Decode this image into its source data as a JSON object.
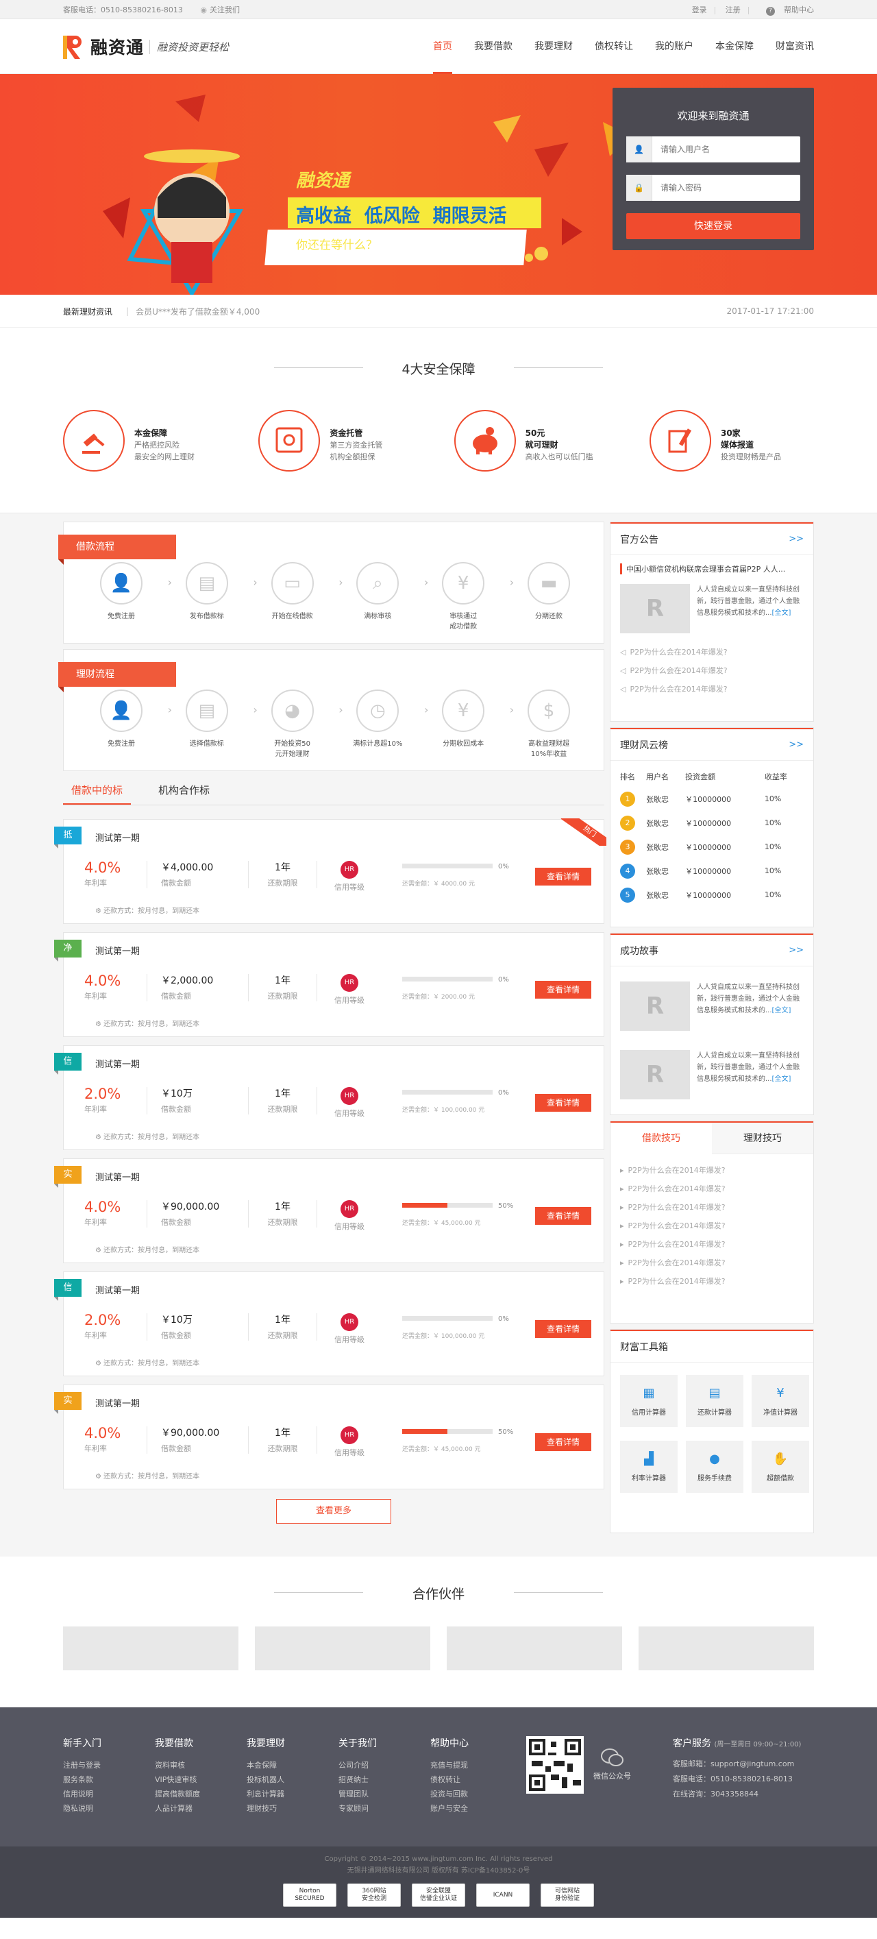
{
  "topbar": {
    "phone": "客服电话：0510-85380216-8013",
    "follow": "关注我们",
    "login": "登录",
    "register": "注册",
    "help": "帮助中心"
  },
  "header": {
    "logo_text": "融资通",
    "slogan": "融资投资更轻松",
    "nav": [
      "首页",
      "我要借款",
      "我要理财",
      "债权转让",
      "我的账户",
      "本金保障",
      "财富资讯"
    ]
  },
  "banner": {
    "line1": "融资通",
    "line2": "高收益  低风险  期限灵活",
    "line3": "你还在等什么？",
    "login_title": "欢迎来到融资通",
    "user_placeholder": "请输入用户名",
    "pwd_placeholder": "请输入密码",
    "login_btn": "快速登录"
  },
  "news": {
    "label": "最新理财资讯",
    "text": "会员U***发布了借款金额￥4,000",
    "date": "2017-01-17 17:21:00"
  },
  "security": {
    "title": "4大安全保障",
    "items": [
      {
        "t": "本金保障",
        "d1": "严格把控风险",
        "d2": "最安全的网上理财"
      },
      {
        "t": "资金托管",
        "d1": "第三方资金托管",
        "d2": "机构全额担保"
      },
      {
        "t": "50元",
        "d0": "就可理财",
        "d2": "高收入也可以低门槛"
      },
      {
        "t": "30家",
        "d0": "媒体报道",
        "d2": "投资理财畅是产品"
      }
    ]
  },
  "borrow_flow": {
    "title": "借款流程",
    "steps": [
      "免费注册",
      "发布借款标",
      "开始在线借款",
      "满标审核",
      "审核通过\n成功借款",
      "分期还款"
    ]
  },
  "invest_flow": {
    "title": "理财流程",
    "steps": [
      "免费注册",
      "选择借款标",
      "开始投资50\n元开始理财",
      "满标计息超10%",
      "分期收回成本",
      "高收益理财超\n10%年收益"
    ]
  },
  "loan_tabs": [
    "借款中的标",
    "机构合作标"
  ],
  "loan_labels": {
    "rate": "年利率",
    "amount": "借款金额",
    "term": "还款期限",
    "credit": "信用等级",
    "credit_badge": "HR",
    "pay": "还款方式：按月付息，到期还本",
    "detail": "查看详情",
    "hot": "热门"
  },
  "loans": [
    {
      "tag": "抵",
      "color": "#1aa7d8",
      "title": "测试第一期",
      "rate": "4.0%",
      "amount": "￥4,000.00",
      "term": "1年",
      "progress": 0,
      "pc": "0%",
      "need": "还需金额：￥ 4000.00 元",
      "hot": true
    },
    {
      "tag": "净",
      "color": "#5bb04e",
      "title": "测试第一期",
      "rate": "4.0%",
      "amount": "￥2,000.00",
      "term": "1年",
      "progress": 0,
      "pc": "0%",
      "need": "还需金额：￥ 2000.00 元"
    },
    {
      "tag": "信",
      "color": "#0fa9a4",
      "title": "测试第一期",
      "rate": "2.0%",
      "amount": "￥10万",
      "term": "1年",
      "progress": 0,
      "pc": "0%",
      "need": "还需金额：￥ 100,000.00 元"
    },
    {
      "tag": "实",
      "color": "#f0a21c",
      "title": "测试第一期",
      "rate": "4.0%",
      "amount": "￥90,000.00",
      "term": "1年",
      "progress": 50,
      "pc": "50%",
      "need": "还需金额：￥ 45,000.00 元"
    },
    {
      "tag": "信",
      "color": "#0fa9a4",
      "title": "测试第一期",
      "rate": "2.0%",
      "amount": "￥10万",
      "term": "1年",
      "progress": 0,
      "pc": "0%",
      "need": "还需金额：￥ 100,000.00 元"
    },
    {
      "tag": "实",
      "color": "#f0a21c",
      "title": "测试第一期",
      "rate": "4.0%",
      "amount": "￥90,000.00",
      "term": "1年",
      "progress": 50,
      "pc": "50%",
      "need": "还需金额：￥ 45,000.00 元"
    }
  ],
  "more_btn": "查看更多",
  "notice": {
    "title": "官方公告",
    "more": ">>",
    "headline": "中国小额信贷机构联席会理事会首届P2P 人人...",
    "text": "人人贷自成立以来一直坚持科技创新，践行普惠金融，通过个人金融信息服务模式和技术的...",
    "link": "[全文]",
    "list": [
      "P2P为什么会在2014年爆发?",
      "P2P为什么会在2014年爆发?",
      "P2P为什么会在2014年爆发?"
    ]
  },
  "rank": {
    "title": "理财风云榜",
    "more": ">>",
    "cols": [
      "排名",
      "用户名",
      "投资金额",
      "收益率"
    ],
    "rows": [
      {
        "n": "1",
        "c": "#f3b21a",
        "u": "张耿忠",
        "a": "￥10000000",
        "r": "10%"
      },
      {
        "n": "2",
        "c": "#f3b21a",
        "u": "张耿忠",
        "a": "￥10000000",
        "r": "10%"
      },
      {
        "n": "3",
        "c": "#f39a1a",
        "u": "张耿忠",
        "a": "￥10000000",
        "r": "10%"
      },
      {
        "n": "4",
        "c": "#2a8fdc",
        "u": "张耿忠",
        "a": "￥10000000",
        "r": "10%"
      },
      {
        "n": "5",
        "c": "#2a8fdc",
        "u": "张耿忠",
        "a": "￥10000000",
        "r": "10%"
      }
    ]
  },
  "story": {
    "title": "成功故事",
    "more": ">>",
    "text": "人人贷自成立以来一直坚持科技创新，践行普惠金融，通过个人金融信息服务模式和技术的...",
    "link": "[全文]"
  },
  "tips": {
    "tabs": [
      "借款技巧",
      "理财技巧"
    ],
    "list": [
      "P2P为什么会在2014年爆发?",
      "P2P为什么会在2014年爆发?",
      "P2P为什么会在2014年爆发?",
      "P2P为什么会在2014年爆发?",
      "P2P为什么会在2014年爆发?",
      "P2P为什么会在2014年爆发?",
      "P2P为什么会在2014年爆发?"
    ]
  },
  "tools": {
    "title": "财富工具箱",
    "items": [
      {
        "icon": "calculator-icon",
        "label": "信用计算器",
        "glyph": "▦"
      },
      {
        "icon": "grid-icon",
        "label": "还款计算器",
        "glyph": "▤"
      },
      {
        "icon": "yen-icon",
        "label": "净值计算器",
        "glyph": "¥"
      },
      {
        "icon": "chart-icon",
        "label": "利率计算器",
        "glyph": "▟"
      },
      {
        "icon": "service-icon",
        "label": "服务手续费",
        "glyph": "●"
      },
      {
        "icon": "hand-money-icon",
        "label": "超额借款",
        "glyph": "✋"
      }
    ]
  },
  "partners": {
    "title": "合作伙伴"
  },
  "footer": {
    "cols": [
      {
        "h": "新手入门",
        "items": [
          "注册与登录",
          "服务条款",
          "信用说明",
          "隐私说明"
        ]
      },
      {
        "h": "我要借款",
        "items": [
          "资料审核",
          "VIP快速审核",
          "提高借款额度",
          "人品计算器"
        ]
      },
      {
        "h": "我要理财",
        "items": [
          "本金保障",
          "投标机器人",
          "利息计算器",
          "理财技巧"
        ]
      },
      {
        "h": "关于我们",
        "items": [
          "公司介绍",
          "招贤纳士",
          "管理团队",
          "专家顾问"
        ]
      },
      {
        "h": "帮助中心",
        "items": [
          "充值与提现",
          "债权转让",
          "投资与回款",
          "账户与安全"
        ]
      }
    ],
    "wechat": "微信公众号",
    "cs_title": "客户服务",
    "cs_hours": "(周一至周日 09:00~21:00)",
    "cs_email": "客服邮箱：support@jingtum.com",
    "cs_phone": "客服电话：0510-85380216-8013",
    "cs_online": "在线咨询：3043358844",
    "copy1": "Copyright © 2014~2015 www.jingtum.com Inc. All rights reserved",
    "copy2": "无锡井通网络科技有限公司 版权所有 苏ICP备1403852-0号",
    "badges": [
      "Norton\nSECURED",
      "360网站\n安全检测",
      "安全联盟\n信誉企业认证",
      "ICANN",
      "可信网站\n身份验证"
    ]
  }
}
